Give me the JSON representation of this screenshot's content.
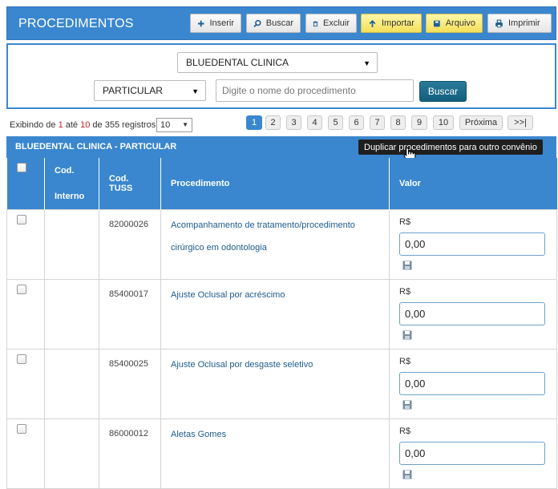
{
  "header": {
    "title": "PROCEDIMENTOS",
    "buttons": [
      {
        "label": "Inserir",
        "icon": "plus-icon"
      },
      {
        "label": "Buscar",
        "icon": "search-icon"
      },
      {
        "label": "Excluir",
        "icon": "trash-icon"
      },
      {
        "label": "Importar",
        "icon": "upload-arrow-icon"
      },
      {
        "label": "Arquivo",
        "icon": "archive-icon"
      },
      {
        "label": "Imprimir",
        "icon": "printer-icon"
      }
    ]
  },
  "filters": {
    "clinic_value": "BLUEDENTAL CLINICA",
    "plan_value": "PARTICULAR",
    "search_placeholder": "Digite o nome do procedimento",
    "search_button": "Buscar"
  },
  "listing": {
    "prefix": "Exibindo de",
    "from": "1",
    "sep1": "até",
    "to": "10",
    "sep2": "de 355 registros",
    "per_page": "10"
  },
  "pagination": [
    "1",
    "2",
    "3",
    "4",
    "5",
    "6",
    "7",
    "8",
    "9",
    "10",
    "Próxima",
    ">>|"
  ],
  "pagination_active": "1",
  "table": {
    "caption": "BLUEDENTAL CLINICA - PARTICULAR",
    "tooltip": "Duplicar procedimentos para outro convênio",
    "headers": {
      "internal_code_line1": "Cod.",
      "internal_code_line2": "Interno",
      "tuss": "Cod. TUSS",
      "procedure": "Procedimento",
      "value": "Valor"
    },
    "currency": "R$",
    "rows": [
      {
        "internal": "",
        "tuss": "82000026",
        "procedure_line1": "Acompanhamento de tratamento/procedimento",
        "procedure_line2": "cirúrgico em odontologia",
        "value": "0,00"
      },
      {
        "internal": "",
        "tuss": "85400017",
        "procedure_line1": "Ajuste Oclusal por acréscimo",
        "procedure_line2": "",
        "value": "0,00"
      },
      {
        "internal": "",
        "tuss": "85400025",
        "procedure_line1": "Ajuste Oclusal por desgaste seletivo",
        "procedure_line2": "",
        "value": "0,00"
      },
      {
        "internal": "",
        "tuss": "86000012",
        "procedure_line1": "Aletas Gomes",
        "procedure_line2": "",
        "value": "0,00"
      }
    ]
  },
  "colors": {
    "brand_blue": "#3a87cf",
    "search_button": "#135e7d",
    "link": "#1e5b8c",
    "highlight_red": "#d01e1e",
    "import_yellow": "#f4df5a"
  }
}
